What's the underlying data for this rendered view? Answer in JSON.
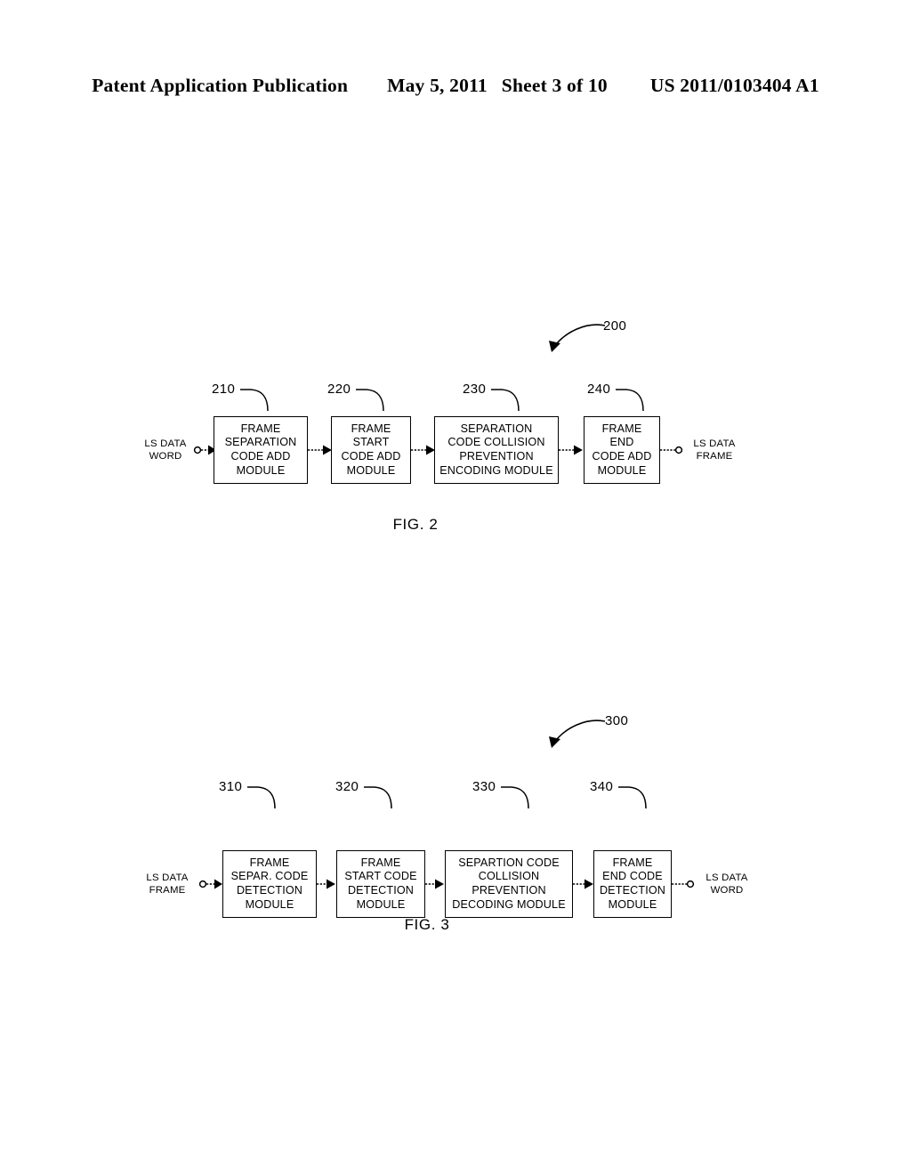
{
  "header": {
    "publication": "Patent Application Publication",
    "date": "May 5, 2011",
    "sheet": "Sheet 3 of 10",
    "number": "US 2011/0103404 A1"
  },
  "figures": [
    {
      "id": "figure-2",
      "caption": "FIG. 2",
      "callout": "200",
      "input_label_line1": "LS DATA",
      "input_label_line2": "WORD",
      "output_label_line1": "LS DATA",
      "output_label_line2": "FRAME",
      "blocks": [
        {
          "ref": "210",
          "lines": [
            "FRAME",
            "SEPARATION",
            "CODE ADD",
            "MODULE"
          ]
        },
        {
          "ref": "220",
          "lines": [
            "FRAME",
            "START",
            "CODE ADD",
            "MODULE"
          ]
        },
        {
          "ref": "230",
          "lines": [
            "SEPARATION",
            "CODE COLLISION",
            "PREVENTION",
            "ENCODING MODULE"
          ]
        },
        {
          "ref": "240",
          "lines": [
            "FRAME",
            "END",
            "CODE ADD",
            "MODULE"
          ]
        }
      ]
    },
    {
      "id": "figure-3",
      "caption": "FIG. 3",
      "callout": "300",
      "input_label_line1": "LS DATA",
      "input_label_line2": "FRAME",
      "output_label_line1": "LS DATA",
      "output_label_line2": "WORD",
      "blocks": [
        {
          "ref": "310",
          "lines": [
            "FRAME",
            "SEPAR. CODE",
            "DETECTION",
            "MODULE"
          ]
        },
        {
          "ref": "320",
          "lines": [
            "FRAME",
            "START CODE",
            "DETECTION",
            "MODULE"
          ]
        },
        {
          "ref": "330",
          "lines": [
            "SEPARTION CODE",
            "COLLISION",
            "PREVENTION",
            "DECODING MODULE"
          ]
        },
        {
          "ref": "340",
          "lines": [
            "FRAME",
            "END CODE",
            "DETECTION",
            "MODULE"
          ]
        }
      ]
    }
  ],
  "colors": {
    "ink": "#000000",
    "paper": "#ffffff"
  }
}
